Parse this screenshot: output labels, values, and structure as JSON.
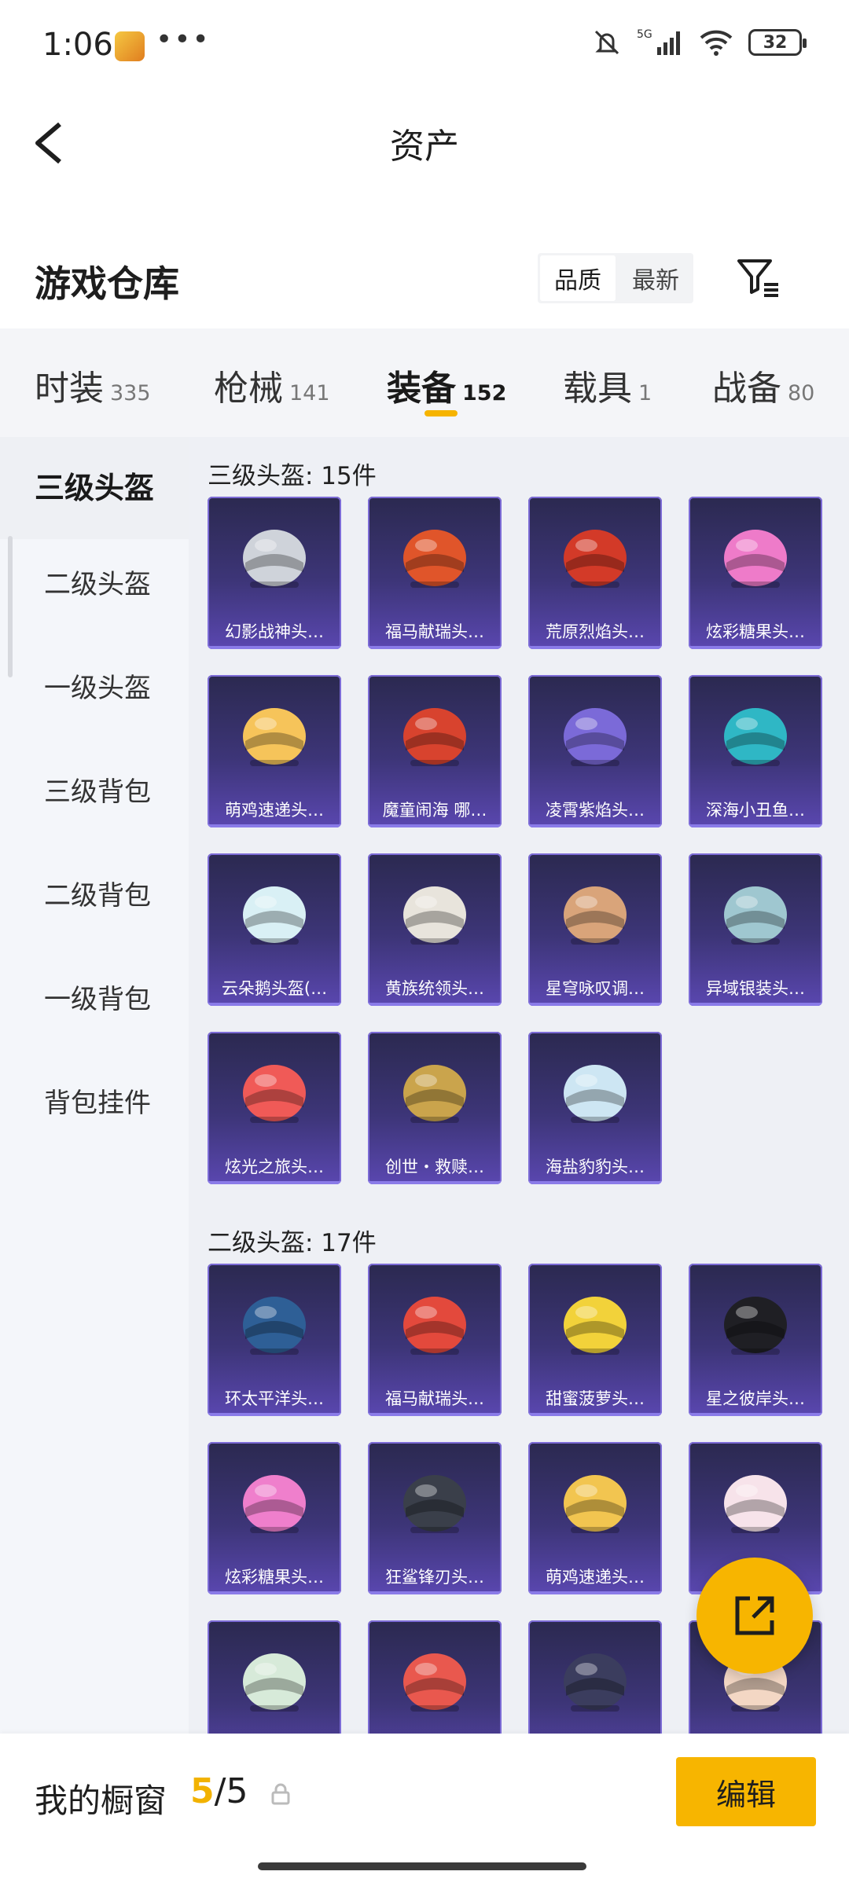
{
  "status": {
    "time": "1:06",
    "battery": "32",
    "network": "5G"
  },
  "header": {
    "title": "资产"
  },
  "warehouse": {
    "title": "游戏仓库",
    "sort_options": [
      "品质",
      "最新"
    ],
    "sort_selected": "品质"
  },
  "tabs": [
    {
      "label": "时装",
      "count": "335",
      "active": false
    },
    {
      "label": "枪械",
      "count": "141",
      "active": false
    },
    {
      "label": "装备",
      "count": "152",
      "active": true
    },
    {
      "label": "载具",
      "count": "1",
      "active": false
    },
    {
      "label": "战备",
      "count": "80",
      "active": false
    }
  ],
  "sidebar": {
    "items": [
      "三级头盔",
      "二级头盔",
      "一级头盔",
      "三级背包",
      "二级背包",
      "一级背包",
      "背包挂件"
    ],
    "active_index": 0
  },
  "sections": [
    {
      "title": "三级头盔: 15件",
      "items": [
        "幻影战神头…",
        "福马献瑞头…",
        "荒原烈焰头…",
        "炫彩糖果头…",
        "萌鸡速递头…",
        "魔童闹海 哪…",
        "凌霄紫焰头…",
        "深海小丑鱼…",
        "云朵鹅头盔(…",
        "黄族统领头…",
        "星穹咏叹调…",
        "异域银装头…",
        "炫光之旅头…",
        "创世・救赎…",
        "海盐豹豹头…"
      ]
    },
    {
      "title": "二级头盔: 17件",
      "items": [
        "环太平洋头…",
        "福马献瑞头…",
        "甜蜜菠萝头…",
        "星之彼岸头…",
        "炫彩糖果头…",
        "狂鲨锋刃头…",
        "萌鸡速递头…",
        "",
        "",
        "",
        "",
        ""
      ]
    }
  ],
  "colors": {
    "item_art": [
      "#cfd3da",
      "#e0552a",
      "#d33a28",
      "#ee7bc9",
      "#f6c45a",
      "#d8432e",
      "#7b6ad8",
      "#2fb7c5",
      "#d9f0f5",
      "#e8e4dc",
      "#d9a47a",
      "#9fc7d0",
      "#f05a57",
      "#caa44c",
      "#cde6f3",
      "#2e5f96",
      "#e3493c",
      "#f2d23a",
      "#1f1f24",
      "#ef7fcc",
      "#3a3f4a",
      "#f2c550",
      "#f7e3ea",
      "#d7ead9",
      "#e9584e",
      "#3b3d5e",
      "#f3d7c4"
    ]
  },
  "showcase": {
    "label": "我的橱窗",
    "current": "5",
    "total": "5",
    "edit_label": "编辑"
  }
}
